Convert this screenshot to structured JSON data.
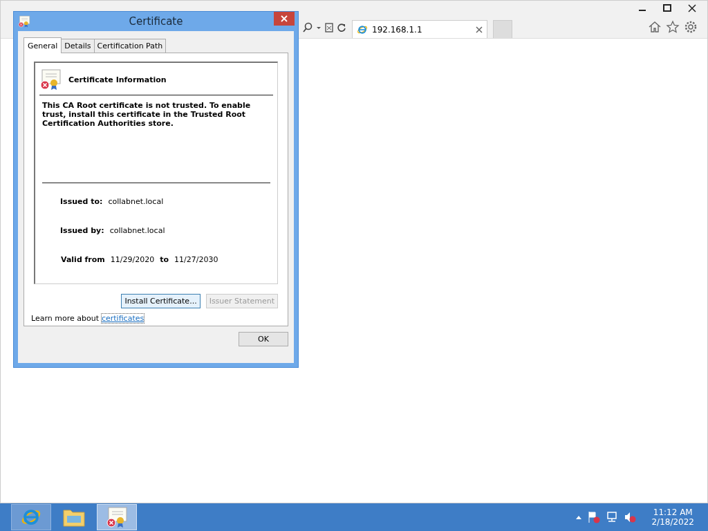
{
  "browser": {
    "tab": {
      "title": "192.168.1.1"
    }
  },
  "dialog": {
    "title": "Certificate",
    "tabs": [
      {
        "label": "General",
        "selected": true
      },
      {
        "label": "Details",
        "selected": false
      },
      {
        "label": "Certification Path",
        "selected": false
      }
    ],
    "heading": "Certificate Information",
    "message": "This CA Root certificate is not trusted. To enable trust, install this certificate in the Trusted Root Certification Authorities store.",
    "fields": [
      {
        "label": "Issued to:",
        "value": "collabnet.local"
      },
      {
        "label": "Issued by:",
        "value": "collabnet.local"
      }
    ],
    "validity": {
      "label": "Valid from",
      "from": "11/29/2020",
      "to_label": "to",
      "to": "11/27/2030"
    },
    "buttons": [
      {
        "label": "Install Certificate...",
        "disabled": false
      },
      {
        "label": "Issuer Statement",
        "disabled": true
      }
    ],
    "learn_more": {
      "text": "Learn more about",
      "link": "certificates"
    },
    "ok": "OK"
  },
  "taskbar": {
    "items": [
      {
        "kind": "browser",
        "running": true,
        "selected": false
      },
      {
        "kind": "folder",
        "running": false,
        "selected": false
      },
      {
        "kind": "certificate",
        "running": true,
        "selected": true
      }
    ],
    "time": "11:12 AM",
    "date": "2/18/2022"
  }
}
